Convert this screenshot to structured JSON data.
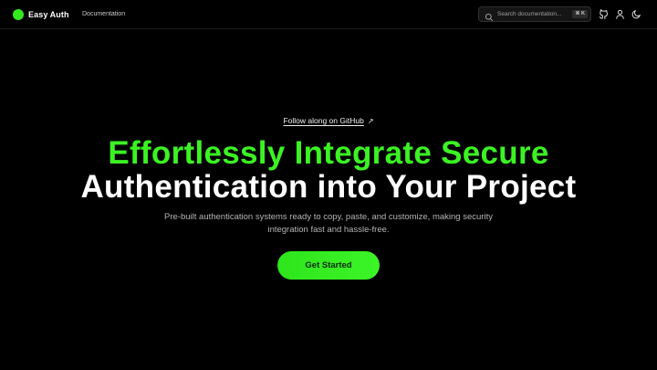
{
  "header": {
    "brand_name": "Easy Auth",
    "nav_documentation": "Documentation",
    "search": {
      "placeholder": "Search documentation...",
      "shortcut": "⌘ K"
    },
    "icons": [
      "github-icon",
      "user-icon",
      "moon-icon"
    ]
  },
  "hero": {
    "github_link": "Follow along on GitHub",
    "headline_line1": "Effortlessly Integrate Secure",
    "headline_line2": "Authentication into Your Project",
    "subtitle_line1": "Pre-built authentication systems ready to copy, paste, and customize, making security",
    "subtitle_line2": "integration fast and hassle-free.",
    "cta_label": "Get Started"
  },
  "colors": {
    "accent": "#3cf224",
    "background": "#000000",
    "text": "#ffffff",
    "muted": "#b4b4b4"
  }
}
